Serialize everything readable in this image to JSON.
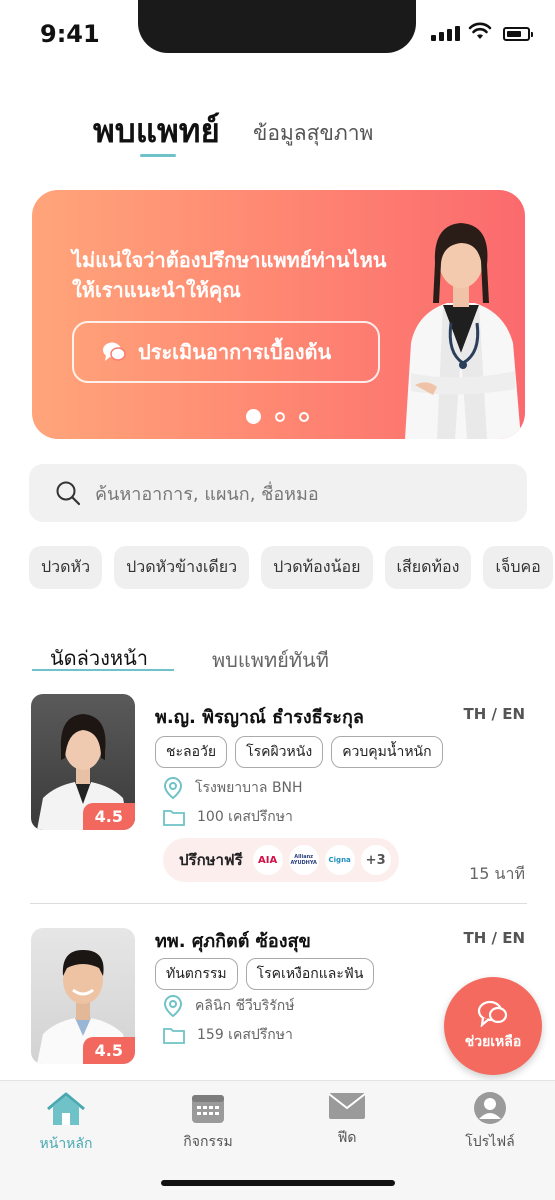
{
  "status_bar": {
    "time": "9:41"
  },
  "top_tabs": {
    "active": "พบแพทย์",
    "other": "ข้อมูลสุขภาพ"
  },
  "banner": {
    "line1": "ไม่แน่ใจว่าต้องปรึกษาแพทย์ท่านไหน",
    "line2": "ให้เราแนะนำให้คุณ",
    "button": "ประเมินอาการเบื้องต้น",
    "slides": 3,
    "active_slide": 1
  },
  "search": {
    "placeholder": "ค้นหาอาการ, แผนก, ชื่อหมอ"
  },
  "chips": [
    "ปวดหัว",
    "ปวดหัวข้างเดียว",
    "ปวดท้องน้อย",
    "เสียดท้อง",
    "เจ็บคอ"
  ],
  "sub_tabs": {
    "active": "นัดล่วงหน้า",
    "other": "พบแพทย์ทันที"
  },
  "doctors": [
    {
      "name": "พ.ญ. พิรญาณ์ ธำรงธีระกุล",
      "lang": "TH / EN",
      "tags": [
        "ชะลอวัย",
        "โรคผิวหนัง",
        "ควบคุมน้ำหนัก"
      ],
      "place": "โรงพยาบาล BNH",
      "cases": "100 เคสปรึกษา",
      "rating": "4.5",
      "free_label": "ปรึกษาฟรี",
      "insurers": [
        "AIA",
        "Allianz AYUDHYA",
        "Cigna"
      ],
      "more": "+3",
      "duration": "15 นาที"
    },
    {
      "name": "ทพ. ศุภกิตต์ ซ้องสุข",
      "lang": "TH / EN",
      "tags": [
        "ทันตกรรม",
        "โรคเหงือกและฟัน"
      ],
      "place": "คลินิก ชีวีบริรักษ์",
      "cases": "159 เคสปรึกษา",
      "rating": "4.5"
    }
  ],
  "help_button": {
    "label": "ช่วยเหลือ"
  },
  "bottom_nav": [
    {
      "label": "หน้าหลัก",
      "icon": "home-icon",
      "active": true
    },
    {
      "label": "กิจกรรม",
      "icon": "calendar-icon",
      "active": false
    },
    {
      "label": "ฟีด",
      "icon": "mail-icon",
      "active": false
    },
    {
      "label": "โปรไฟล์",
      "icon": "profile-icon",
      "active": false
    }
  ],
  "colors": {
    "accent": "#6fc2c7",
    "coral": "#f46a5e",
    "active_nav": "#4aa9b0"
  }
}
